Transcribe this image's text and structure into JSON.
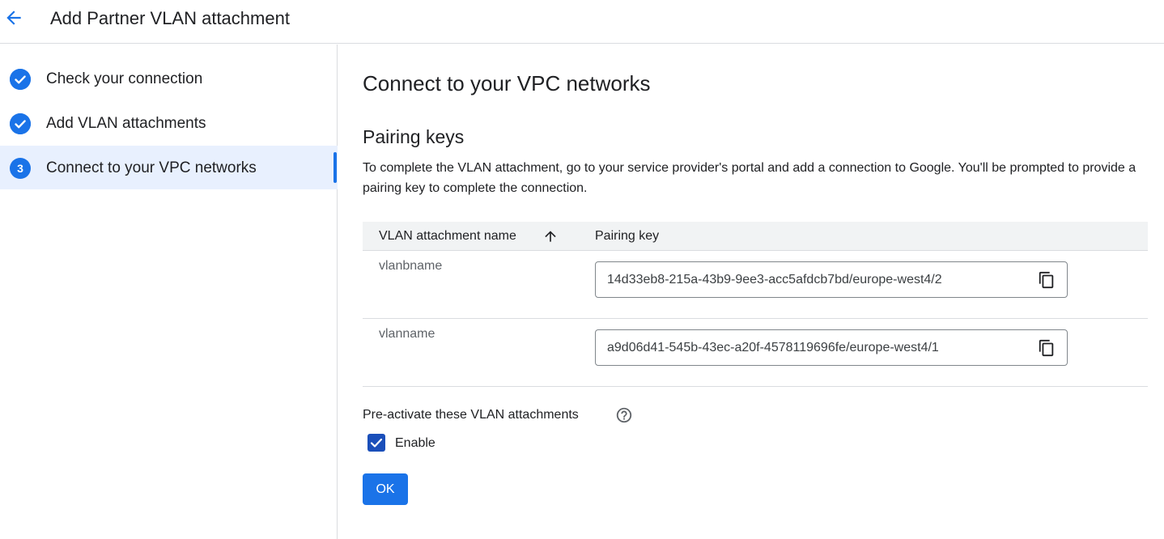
{
  "header": {
    "title": "Add Partner VLAN attachment",
    "back_icon": "arrow-back-icon"
  },
  "sidebar": {
    "steps": [
      {
        "label": "Check your connection",
        "state": "complete",
        "icon": "check-circle-icon"
      },
      {
        "label": "Add VLAN attachments",
        "state": "complete",
        "icon": "check-circle-icon"
      },
      {
        "label": "Connect to your VPC networks",
        "state": "active",
        "number": "3"
      }
    ]
  },
  "main": {
    "title": "Connect to your VPC networks",
    "section_title": "Pairing keys",
    "description": "To complete the VLAN attachment, go to your service provider's portal and add a connection to Google. You'll be prompted to provide a pairing key to complete the connection.",
    "table": {
      "columns": [
        "VLAN attachment name",
        "Pairing key"
      ],
      "sort_icon": "arrow-up-icon",
      "rows": [
        {
          "name": "vlanbname",
          "pairing_key": "14d33eb8-215a-43b9-9ee3-acc5afdcb7bd/europe-west4/2"
        },
        {
          "name": "vlanname",
          "pairing_key": "a9d06d41-545b-43ec-a20f-4578119696fe/europe-west4/1"
        }
      ]
    },
    "preactivate": {
      "label": "Pre-activate these VLAN attachments",
      "help_icon": "help-circle-icon",
      "checkbox_label": "Enable",
      "checked": true
    },
    "ok_button": "OK"
  },
  "colors": {
    "accent": "#1a73e8",
    "active_step_bg": "#e8f0fe",
    "checkbox": "#1a4fba",
    "divider": "#dadce0"
  }
}
